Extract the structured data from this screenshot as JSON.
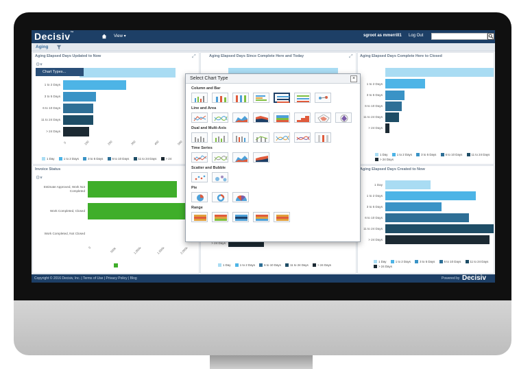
{
  "colors": {
    "c1": "#a9dcf3",
    "c2": "#4db4e6",
    "c3": "#3a93c6",
    "c4": "#2e6f96",
    "c5": "#1e4d66",
    "c6": "#1c2a33",
    "green": "#3fae2a",
    "brand": "#1d3f66"
  },
  "header": {
    "logo": "Decisiv",
    "tm": "™",
    "view": "View ▾",
    "user": "sgroot as mmerrill1",
    "logout": "Log Out",
    "search_placeholder": ""
  },
  "subbar": {
    "crumb": "Aging"
  },
  "panel1": {
    "title": "Aging Elapsed Days Updated to Now",
    "menu_item": "Chart Types...",
    "categories": [
      "1 to 2 Days",
      "3 to 5 Days",
      "6 to 10 Days",
      "11 to 24 Days",
      "> 24 Days"
    ],
    "ticks": [
      "0",
      "100",
      "200",
      "300",
      "400",
      "500"
    ],
    "legend": [
      "1 Day",
      "1 to 2 Days",
      "3 to 5 Days",
      "6 to 10 Days",
      "11 to 24 Days",
      "> 24"
    ]
  },
  "panel2": {
    "title": "Aging Elapsed Days Since Complete Here and Today"
  },
  "panel3": {
    "title": "Aging Elapsed Days Complete Here to Closed",
    "categories": [
      "1 to 2 Days",
      "3 to 5 Days",
      "6 to 10 Days",
      "11 to 24 Days",
      "> 24 Days"
    ],
    "legend": [
      "1 Day",
      "1 to 2 Days",
      "3 to 5 Days",
      "6 to 10 Days",
      "11 to 24 Days",
      "> 24 Days"
    ]
  },
  "panel4": {
    "title": "Invoice Status",
    "categories": [
      "Estimate Approved, Work Not Completed",
      "Work Completed, Closed",
      "Work Completed, Not Closed"
    ],
    "ticks": [
      "0",
      "500k",
      "1,000k",
      "1,500k",
      "2,000k"
    ]
  },
  "panel5": {
    "categories": [
      "> 24 Days"
    ],
    "ticks": [
      "0",
      "1",
      "2",
      "3",
      "4",
      "5",
      "6",
      "7",
      "8",
      "9",
      "10"
    ],
    "legend": [
      "1 Day",
      "1 to 2 Days",
      "6 to 10 Days",
      "11 to 24 Days",
      "> 24 Days"
    ]
  },
  "panel6": {
    "title": "Aging Elapsed Days Created to Now",
    "categories": [
      "1 Day",
      "1 to 2 Days",
      "3 to 5 Days",
      "6 to 10 Days",
      "11 to 24 Days",
      "> 24 Days"
    ],
    "legend": [
      "1 Day",
      "1 to 2 Days",
      "3 to 5 Days",
      "6 to 10 Days",
      "11 to 24 Days",
      "> 24 Days"
    ]
  },
  "dialog": {
    "title": "Select Chart Type",
    "close": "×",
    "sections": [
      "Column and Bar",
      "Line and Area",
      "Dual and Multi-Axis",
      "Time Series",
      "Scatter and Bubble",
      "Pie",
      "Range"
    ]
  },
  "footer": {
    "copyright": "Copyright © 2016 Decisiv, Inc. | Terms of Use | Privacy Policy | Blog",
    "powered": "Powered by",
    "logo": "Decisiv"
  }
}
